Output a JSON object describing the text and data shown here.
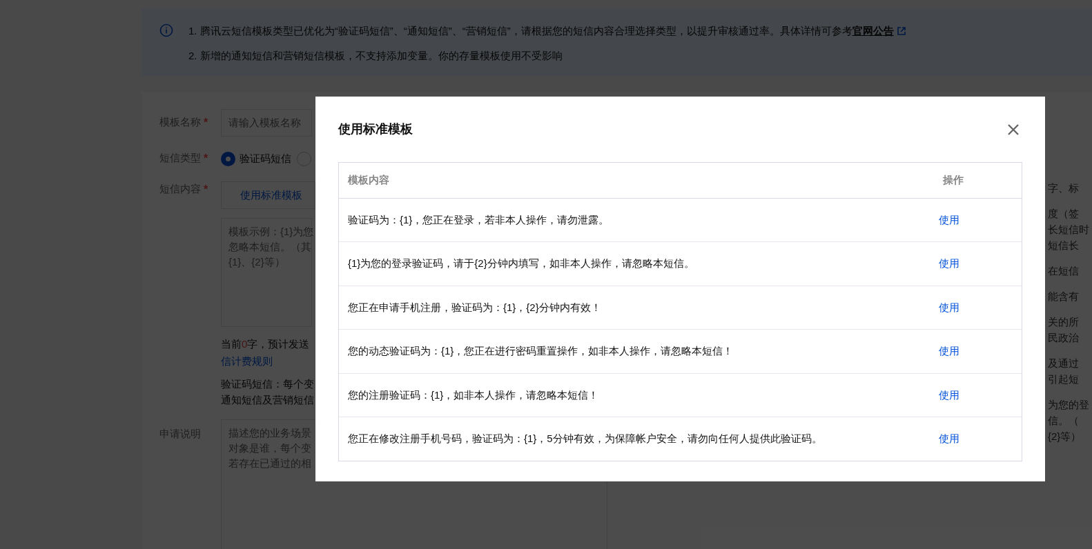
{
  "notice": {
    "lines": [
      "1. 腾讯云短信模板类型已优化为“验证码短信”、“通知短信”、“营销短信”，请根据您的短信内容合理选择类型，以提升审核通过率。具体详情可参考**官网公告**",
      "2. 新增的通知短信和营销短信模板，不支持添加变量。你的存量模板使用不受影响"
    ]
  },
  "form": {
    "name_label": "模板名称",
    "name_required": "*",
    "name_placeholder": "请输入模板名称",
    "type_label": "短信类型",
    "type_required": "*",
    "type_options": [
      {
        "label": "验证码短信",
        "selected": true
      },
      {
        "selected": false
      }
    ],
    "content_label": "短信内容",
    "content_required": "*",
    "template_button": "使用标准模板",
    "content_placeholder": [
      "模板示例：{1}为您",
      "忽略本短信。（其",
      "{1}、{2}等）"
    ],
    "count_prefix": "当前",
    "count": "0",
    "count_suffix": "字，预计发送",
    "billing_link": "信计费规则",
    "variable_note": [
      "验证码短信：每个变",
      "通知短信及营销短信"
    ],
    "desc_label": "申请说明",
    "desc_placeholder": [
      "描述您的业务场景",
      "对象是谁，每个变",
      "若存在已通过的相"
    ]
  },
  "side_notes": [
    [
      "字、标"
    ],
    [
      "度（签",
      "长短信时",
      "短信长"
    ],
    [
      "在短信"
    ],
    [
      "能含有"
    ],
    [
      "关的所",
      "民政治"
    ],
    [
      "及通过",
      "引起短"
    ],
    [
      "为您的登",
      "信。（",
      "{2}等）"
    ]
  ],
  "dialog": {
    "title": "使用标准模板",
    "columns": [
      "模板内容",
      "操作"
    ],
    "rows": [
      {
        "content": "验证码为：{1}，您正在登录，若非本人操作，请勿泄露。",
        "action": "使用"
      },
      {
        "content": "{1}为您的登录验证码，请于{2}分钟内填写，如非本人操作，请忽略本短信。",
        "action": "使用"
      },
      {
        "content": "您正在申请手机注册，验证码为：{1}，{2}分钟内有效！",
        "action": "使用"
      },
      {
        "content": "您的动态验证码为：{1}，您正在进行密码重置操作，如非本人操作，请忽略本短信！",
        "action": "使用"
      },
      {
        "content": "您的注册验证码：{1}，如非本人操作，请忽略本短信！",
        "action": "使用"
      },
      {
        "content": "您正在修改注册手机号码，验证码为：{1}，5分钟有效，为保障帐户安全，请勿向任何人提供此验证码。",
        "action": "使用"
      }
    ]
  }
}
